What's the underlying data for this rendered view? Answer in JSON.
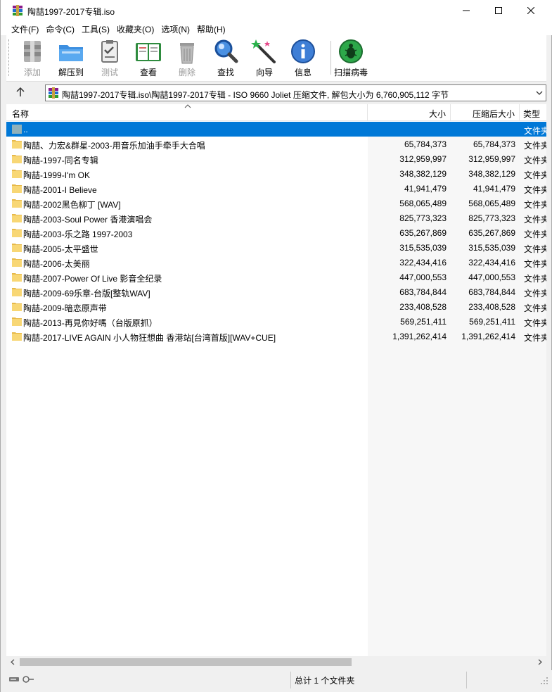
{
  "window": {
    "title": "陶喆1997-2017专辑.iso"
  },
  "menu": [
    "文件(F)",
    "命令(C)",
    "工具(S)",
    "收藏夹(O)",
    "选项(N)",
    "帮助(H)"
  ],
  "toolbar": {
    "add": "添加",
    "extract": "解压到",
    "test": "测试",
    "view": "查看",
    "delete": "删除",
    "find": "查找",
    "wizard": "向导",
    "info": "信息",
    "scan": "扫描病毒"
  },
  "address": {
    "path": "陶喆1997-2017专辑.iso\\陶喆1997-2017专辑 - ISO 9660 Joliet 压缩文件, 解包大小为 6,760,905,112 字节"
  },
  "columns": {
    "name": "名称",
    "size": "大小",
    "packed": "压缩后大小",
    "type": "类型"
  },
  "rows": [
    {
      "name": "..",
      "size": "",
      "packed": "",
      "type": "文件夹",
      "selected": true
    },
    {
      "name": "陶喆、力宏&群星-2003-用音乐加油手牵手大合唱",
      "size": "65,784,373",
      "packed": "65,784,373",
      "type": "文件夹"
    },
    {
      "name": "陶喆-1997-同名专辑",
      "size": "312,959,997",
      "packed": "312,959,997",
      "type": "文件夹"
    },
    {
      "name": "陶喆-1999-I'm OK",
      "size": "348,382,129",
      "packed": "348,382,129",
      "type": "文件夹"
    },
    {
      "name": "陶喆-2001-I Believe",
      "size": "41,941,479",
      "packed": "41,941,479",
      "type": "文件夹"
    },
    {
      "name": "陶喆-2002黑色柳丁 [WAV]",
      "size": "568,065,489",
      "packed": "568,065,489",
      "type": "文件夹"
    },
    {
      "name": "陶喆-2003-Soul Power 香港演唱会",
      "size": "825,773,323",
      "packed": "825,773,323",
      "type": "文件夹"
    },
    {
      "name": "陶喆-2003-乐之路 1997-2003",
      "size": "635,267,869",
      "packed": "635,267,869",
      "type": "文件夹"
    },
    {
      "name": "陶喆-2005-太平盛世",
      "size": "315,535,039",
      "packed": "315,535,039",
      "type": "文件夹"
    },
    {
      "name": "陶喆-2006-太美丽",
      "size": "322,434,416",
      "packed": "322,434,416",
      "type": "文件夹"
    },
    {
      "name": "陶喆-2007-Power Of Live 影音全纪录",
      "size": "447,000,553",
      "packed": "447,000,553",
      "type": "文件夹"
    },
    {
      "name": "陶喆-2009-69乐章-台版[整轨WAV]",
      "size": "683,784,844",
      "packed": "683,784,844",
      "type": "文件夹"
    },
    {
      "name": "陶喆-2009-暗恋原声带",
      "size": "233,408,528",
      "packed": "233,408,528",
      "type": "文件夹"
    },
    {
      "name": "陶喆-2013-再見你好嗎（台版原抓）",
      "size": "569,251,411",
      "packed": "569,251,411",
      "type": "文件夹"
    },
    {
      "name": "陶喆-2017-LIVE AGAIN 小人物狂想曲 香港站[台湾首版][WAV+CUE]",
      "size": "1,391,262,414",
      "packed": "1,391,262,414",
      "type": "文件夹"
    }
  ],
  "status": {
    "text": "总计 1 个文件夹"
  },
  "colors": {
    "selection": "#0078d7",
    "folder": "#f8d775"
  }
}
